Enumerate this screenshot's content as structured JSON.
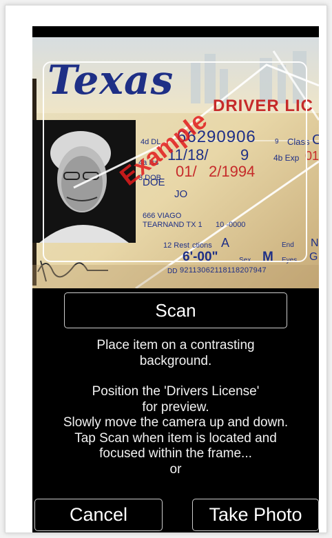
{
  "camera_preview": {
    "license": {
      "state": "Texas",
      "header": "DRIVER LIC",
      "dl": "66290906",
      "issued": "11/18/",
      "issued_tail": "9",
      "dob": "01/",
      "dob_tail": "2/1994",
      "class_label": "Class",
      "class_value": "C",
      "exp_label": "Exp",
      "exp_value": "01",
      "name_line1": "DOE",
      "name_line2": "JO",
      "address1": "666 VIAGO",
      "address2": "TEARNAND TX 1",
      "address2_tail": "10 -0000",
      "restrictions_label": "12 Rest",
      "restrictions_tail": "ctions",
      "restrictions_value": "A",
      "end_label": "End",
      "end_value": "N",
      "height_value": "6'-00\"",
      "sex_label": "Sex",
      "sex_value": "M",
      "eye_label": "Eyes",
      "eye_value": "G",
      "dd_label": "DD",
      "dd_value": "92113062118118207947",
      "watermark": "Example",
      "field_dl": "4d DL",
      "field_iss": "4a Iss",
      "field_dob": "3 DOB",
      "field_exp": "4b Exp",
      "field_class": "9"
    }
  },
  "scan_button": "Scan",
  "instructions": {
    "line1": "Place item on a contrasting",
    "line2": "background.",
    "line3": "Position the 'Drivers License'",
    "line4": "for preview.",
    "line5": "Slowly move the camera up and down.",
    "line6": "Tap Scan when item is located and",
    "line7": "focused within the frame...",
    "line8": "or"
  },
  "cancel_button": "Cancel",
  "take_photo_button": "Take Photo",
  "colors": {
    "screen_bg": "#000000",
    "text": "#f2f2f2",
    "license_blue": "#1e2f86",
    "license_red": "#c62a2a",
    "watermark_red": "#e21d1d"
  }
}
